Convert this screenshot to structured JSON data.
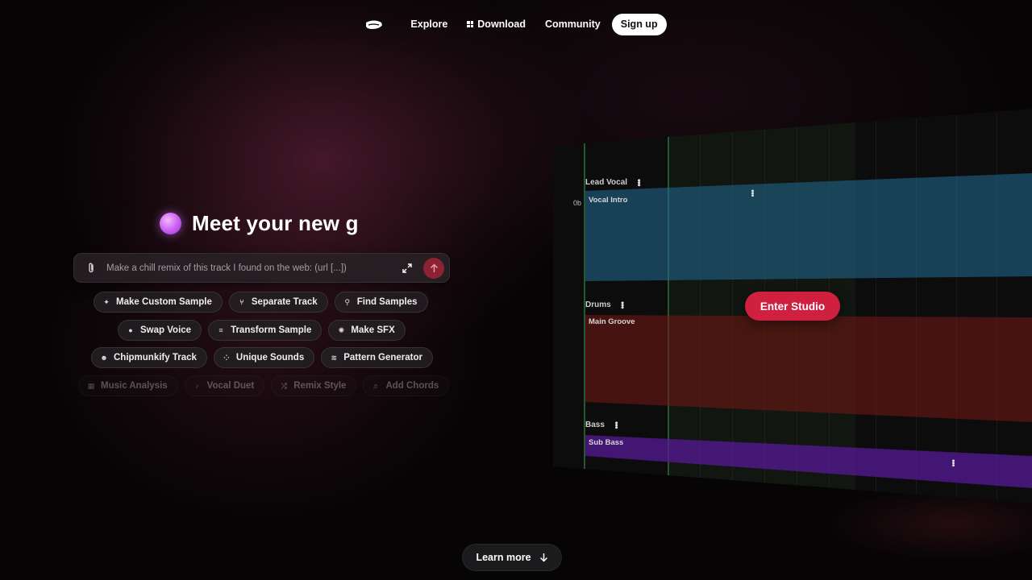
{
  "nav": {
    "logo_icon": "brand-logo-icon",
    "links": [
      {
        "label": "Explore"
      },
      {
        "label": "Download",
        "icon": "windows-icon"
      },
      {
        "label": "Community"
      }
    ],
    "signup_label": "Sign up"
  },
  "hero": {
    "headline": "Meet your new g",
    "orb_colors": [
      "#f6b8ff",
      "#c95cf0"
    ]
  },
  "prompt": {
    "placeholder": "Make a chill remix of this track I found on the web: (url [...])",
    "attach_icon": "paperclip-icon",
    "expand_icon": "expand-icon",
    "send_icon": "arrow-up-icon"
  },
  "chips": {
    "row1": [
      {
        "label": "Make Custom Sample",
        "icon": "sparkle-icon"
      },
      {
        "label": "Separate Track",
        "icon": "split-icon"
      },
      {
        "label": "Find Samples",
        "icon": "search-icon"
      }
    ],
    "row2": [
      {
        "label": "Swap Voice",
        "icon": "user-swap-icon"
      },
      {
        "label": "Transform Sample",
        "icon": "sliders-icon"
      },
      {
        "label": "Make SFX",
        "icon": "sfx-icon"
      }
    ],
    "row3": [
      {
        "label": "Chipmunkify Track",
        "icon": "face-icon"
      },
      {
        "label": "Unique Sounds",
        "icon": "grid-icon"
      },
      {
        "label": "Pattern Generator",
        "icon": "pattern-icon"
      }
    ],
    "row4": [
      {
        "label": "Music Analysis",
        "icon": "chart-icon"
      },
      {
        "label": "Vocal Duet",
        "icon": "mic-icon"
      },
      {
        "label": "Remix Style",
        "icon": "shuffle-icon"
      },
      {
        "label": "Add Chords",
        "icon": "chords-icon"
      }
    ]
  },
  "studio": {
    "tracks": [
      {
        "name": "Lead Vocal",
        "region": "Vocal Intro",
        "color": "#236e96"
      },
      {
        "name": "Drums",
        "region": "Main Groove",
        "color": "#78191a"
      },
      {
        "name": "Bass",
        "region": "Sub Bass",
        "color": "#551996"
      }
    ],
    "offset_label": "0b",
    "enter_label": "Enter Studio",
    "accent": "#d0203f"
  },
  "learn_more": {
    "label": "Learn more",
    "icon": "arrow-down-icon"
  }
}
